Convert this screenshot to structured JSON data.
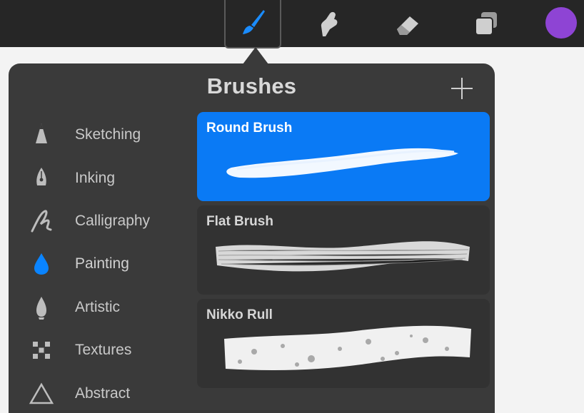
{
  "toolbar": {
    "tools": [
      {
        "name": "paint-brush-icon",
        "selected": true
      },
      {
        "name": "smudge-icon",
        "selected": false
      },
      {
        "name": "eraser-icon",
        "selected": false
      },
      {
        "name": "layers-icon",
        "selected": false
      }
    ],
    "current_color": "#8e44d4",
    "accent_color": "#0a7af5"
  },
  "brushes_panel": {
    "title": "Brushes",
    "add_icon": "plus-icon",
    "categories": [
      {
        "label": "Sketching",
        "icon": "pencil-tip-icon",
        "active": false
      },
      {
        "label": "Inking",
        "icon": "pen-nib-icon",
        "active": false
      },
      {
        "label": "Calligraphy",
        "icon": "calligraphy-squiggle-icon",
        "active": false
      },
      {
        "label": "Painting",
        "icon": "paint-drop-icon",
        "active": true
      },
      {
        "label": "Artistic",
        "icon": "flame-drop-icon",
        "active": false
      },
      {
        "label": "Textures",
        "icon": "checker-pattern-icon",
        "active": false
      },
      {
        "label": "Abstract",
        "icon": "triangle-outline-icon",
        "active": false
      }
    ],
    "brushes": [
      {
        "name": "Round Brush",
        "selected": true
      },
      {
        "name": "Flat Brush",
        "selected": false
      },
      {
        "name": "Nikko Rull",
        "selected": false
      }
    ]
  }
}
